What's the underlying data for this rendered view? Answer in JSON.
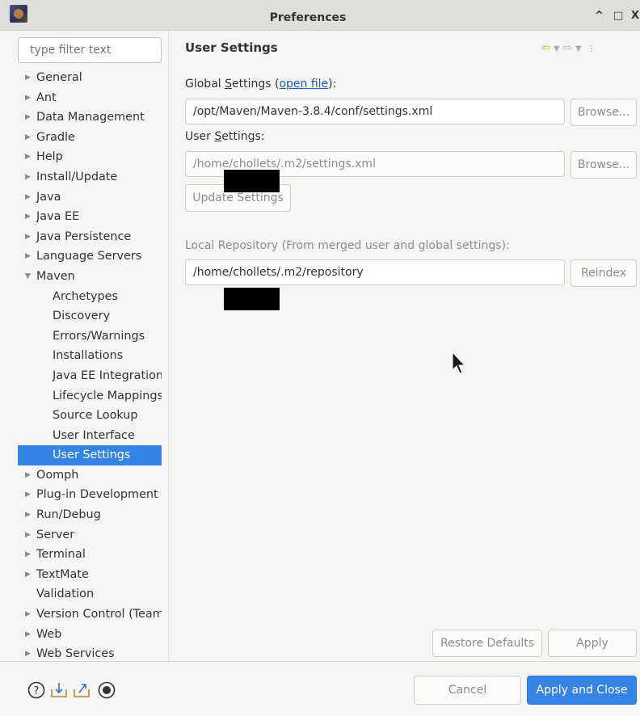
{
  "window": {
    "title": "Preferences",
    "controls": [
      "^",
      "□",
      "X"
    ]
  },
  "filter": {
    "placeholder": "type filter text"
  },
  "tree": [
    {
      "label": "General",
      "expandable": true,
      "child": false,
      "selected": false
    },
    {
      "label": "Ant",
      "expandable": true,
      "child": false,
      "selected": false
    },
    {
      "label": "Data Management",
      "expandable": true,
      "child": false,
      "selected": false
    },
    {
      "label": "Gradle",
      "expandable": true,
      "child": false,
      "selected": false
    },
    {
      "label": "Help",
      "expandable": true,
      "child": false,
      "selected": false
    },
    {
      "label": "Install/Update",
      "expandable": true,
      "child": false,
      "selected": false
    },
    {
      "label": "Java",
      "expandable": true,
      "child": false,
      "selected": false
    },
    {
      "label": "Java EE",
      "expandable": true,
      "child": false,
      "selected": false
    },
    {
      "label": "Java Persistence",
      "expandable": true,
      "child": false,
      "selected": false
    },
    {
      "label": "Language Servers",
      "expandable": true,
      "child": false,
      "selected": false
    },
    {
      "label": "Maven",
      "expandable": true,
      "expanded": true,
      "child": false,
      "selected": false
    },
    {
      "label": "Archetypes",
      "expandable": false,
      "child": true,
      "selected": false
    },
    {
      "label": "Discovery",
      "expandable": false,
      "child": true,
      "selected": false
    },
    {
      "label": "Errors/Warnings",
      "expandable": false,
      "child": true,
      "selected": false
    },
    {
      "label": "Installations",
      "expandable": false,
      "child": true,
      "selected": false
    },
    {
      "label": "Java EE Integration",
      "expandable": false,
      "child": true,
      "selected": false
    },
    {
      "label": "Lifecycle Mappings",
      "expandable": false,
      "child": true,
      "selected": false
    },
    {
      "label": "Source Lookup",
      "expandable": false,
      "child": true,
      "selected": false
    },
    {
      "label": "User Interface",
      "expandable": false,
      "child": true,
      "selected": false
    },
    {
      "label": "User Settings",
      "expandable": false,
      "child": true,
      "selected": true
    },
    {
      "label": "Oomph",
      "expandable": true,
      "child": false,
      "selected": false
    },
    {
      "label": "Plug-in Development",
      "expandable": true,
      "child": false,
      "selected": false
    },
    {
      "label": "Run/Debug",
      "expandable": true,
      "child": false,
      "selected": false
    },
    {
      "label": "Server",
      "expandable": true,
      "child": false,
      "selected": false
    },
    {
      "label": "Terminal",
      "expandable": true,
      "child": false,
      "selected": false
    },
    {
      "label": "TextMate",
      "expandable": true,
      "child": false,
      "selected": false
    },
    {
      "label": "Validation",
      "expandable": false,
      "child": false,
      "selected": false
    },
    {
      "label": "Version Control (Team",
      "expandable": true,
      "child": false,
      "selected": false
    },
    {
      "label": "Web",
      "expandable": true,
      "child": false,
      "selected": false
    },
    {
      "label": "Web Services",
      "expandable": true,
      "child": false,
      "selected": false
    }
  ],
  "page": {
    "title": "User Settings",
    "global_label_prefix": "Global ",
    "global_label_u": "S",
    "global_label_rest": "ettings (",
    "global_link": "open file",
    "global_label_suffix": "):",
    "global_value": "/opt/Maven/Maven-3.8.4/conf/settings.xml",
    "browse": "Browse...",
    "user_label_prefix": "User ",
    "user_label_u": "S",
    "user_label_rest": "ettings:",
    "user_value": "/home/chollets/.m2/settings.xml",
    "update_button": "Update Settings",
    "local_repo_label": "Local Repository (From merged user and global settings):",
    "local_repo_value": "/home/chollets/.m2/repository",
    "reindex": "Reindex"
  },
  "buttons": {
    "restore_defaults": "Restore Defaults",
    "apply": "Apply",
    "cancel": "Cancel",
    "apply_close": "Apply and Close"
  },
  "colors": {
    "accent": "#3584e4",
    "link": "#1a5fb4",
    "nav_arrow": "#e6a117"
  }
}
